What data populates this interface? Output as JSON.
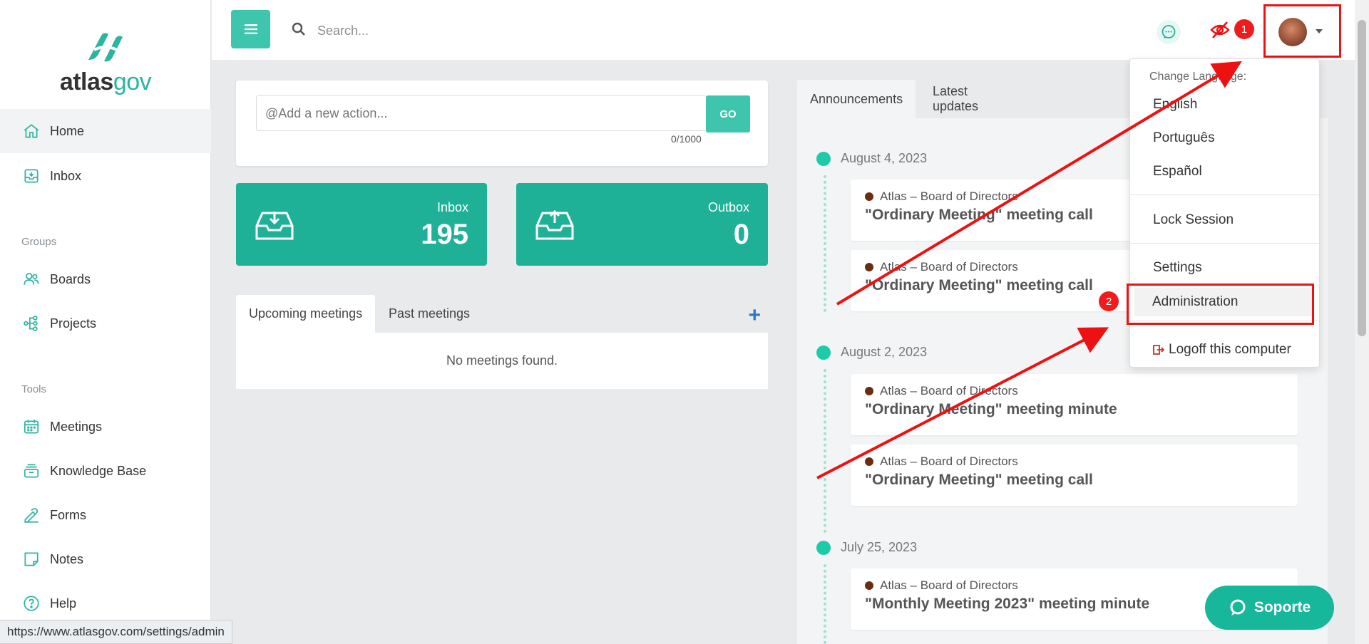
{
  "brand": {
    "name_part1": "atlas",
    "name_part2": "gov"
  },
  "sidebar": {
    "items": [
      {
        "label": "Home"
      },
      {
        "label": "Inbox"
      },
      {
        "label": "Boards"
      },
      {
        "label": "Projects"
      },
      {
        "label": "Meetings"
      },
      {
        "label": "Knowledge Base"
      },
      {
        "label": "Forms"
      },
      {
        "label": "Notes"
      },
      {
        "label": "Help"
      }
    ],
    "groups_label": "Groups",
    "tools_label": "Tools"
  },
  "topbar": {
    "search_placeholder": "Search...",
    "badge1": "1",
    "badge2": "2"
  },
  "action": {
    "placeholder": "@Add a new action...",
    "go_label": "GO",
    "counter": "0/1000"
  },
  "stats": {
    "inbox_label": "Inbox",
    "inbox_value": "195",
    "outbox_label": "Outbox",
    "outbox_value": "0"
  },
  "meetings": {
    "tabs": [
      {
        "label": "Upcoming meetings"
      },
      {
        "label": "Past meetings"
      }
    ],
    "empty": "No meetings found.",
    "add_symbol": "+"
  },
  "announcements": {
    "tabs": [
      {
        "label": "Announcements"
      },
      {
        "label": "Latest updates"
      }
    ],
    "groups": [
      {
        "date": "August 4, 2023",
        "items": [
          {
            "org": "Atlas – Board of Directors",
            "title": "\"Ordinary Meeting\" meeting call"
          },
          {
            "org": "Atlas – Board of Directors",
            "title": "\"Ordinary Meeting\" meeting call"
          }
        ]
      },
      {
        "date": "August 2, 2023",
        "items": [
          {
            "org": "Atlas – Board of Directors",
            "title": "\"Ordinary Meeting\" meeting minute"
          },
          {
            "org": "Atlas – Board of Directors",
            "title": "\"Ordinary Meeting\" meeting call"
          }
        ]
      },
      {
        "date": "July 25, 2023",
        "items": [
          {
            "org": "Atlas – Board of Directors",
            "title": "\"Monthly Meeting 2023\" meeting minute"
          }
        ]
      }
    ]
  },
  "dropdown": {
    "change_language_label": "Change Language:",
    "languages": [
      {
        "label": "English"
      },
      {
        "label": "Português"
      },
      {
        "label": "Español"
      }
    ],
    "lock_session": "Lock Session",
    "settings": "Settings",
    "administration": "Administration",
    "logoff": "Logoff this computer"
  },
  "support_label": "Soporte",
  "status_url": "https://www.atlasgov.com/settings/admin",
  "colors": {
    "accent": "#1fb197",
    "annotation_red": "#ee1c1c",
    "link_blue": "#2a78c2"
  }
}
